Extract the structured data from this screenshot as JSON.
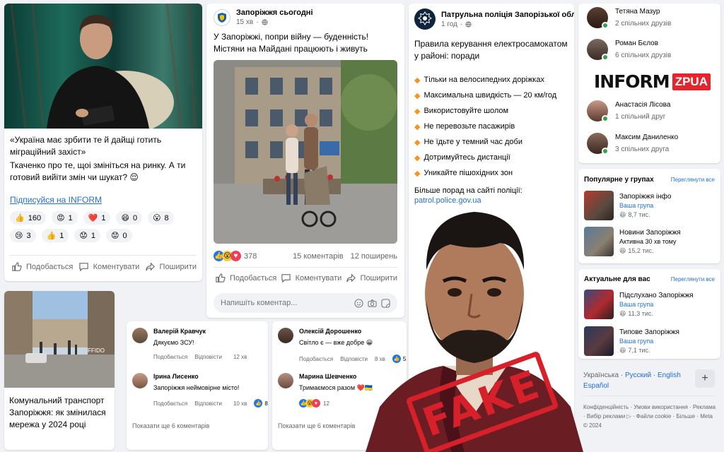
{
  "post1": {
    "quote": "«Україна має зрбити те й дайщі готить міграційний захіст»",
    "text": "Ткаченко про те, щоі змініться на ринку. А ти готовий вийіти змін чи шукат?",
    "text_emoji": "😌",
    "subscribe_link": "Підписуйся на INFORM",
    "reactions": [
      {
        "emoji": "👍",
        "count": "160"
      },
      {
        "emoji": "😡",
        "count": "1"
      },
      {
        "emoji": "❤️",
        "count": "1"
      },
      {
        "emoji": "😄",
        "count": "0"
      },
      {
        "emoji": "😮",
        "count": "8"
      },
      {
        "emoji": "😢",
        "count": "3"
      },
      {
        "emoji": "👍",
        "count": "1"
      },
      {
        "emoji": "😟",
        "count": "1"
      },
      {
        "emoji": "😟",
        "count": "0"
      }
    ],
    "like_label": "Подобається",
    "comment_label": "Коментувати",
    "share_label": "Поширити"
  },
  "post2": {
    "page_name": "Запоріжжя сьогодні",
    "time": "15 хв",
    "text": "У Запоріжжі, попри війну — буденність! Містяни на Майдані працюють і живуть",
    "reaction_count": "378",
    "comments": "15 коментарів",
    "shares": "12 поширень",
    "like_label": "Подобається",
    "comment_label": "Коментувати",
    "share_label": "Поширити",
    "comment_placeholder": "Напишіть коментар..."
  },
  "post3": {
    "page_name": "Патрульна поліція Запорізької області",
    "time": "1 год",
    "title": "Правила керування електросамокатом у районі: поради",
    "rules": [
      "Тільки на велосипедних доріжках",
      "Максимальна швидкість — 20 км/год",
      "Використовуйте шолом",
      "Не перевозьте пасажирів",
      "Не їдьте у темний час доби",
      "Дотримуйтесь дистанції",
      "Уникайте пішохідних зон"
    ],
    "more_text": "Більше порад на сайті поліції:",
    "more_link": "patrol.police.gov.ua"
  },
  "post4": {
    "photo_caption": "FFIDO",
    "text": "Комунальний транспорт Запоріжжя: як змінилася мережа у 2024 році"
  },
  "comments_left": {
    "items": [
      {
        "name": "Валерій Кравчук",
        "text": "Дякуємо ЗСУ!",
        "like": "Подобається",
        "reply": "Відповісти",
        "time": "12 хв",
        "reaction_count": ""
      },
      {
        "name": "Ірина Лисенко",
        "text": "Запоріжжя неймовірне місто!",
        "like": "Подобається",
        "reply": "Відповісти",
        "time": "10 хв",
        "reaction_count": "8"
      }
    ],
    "more": "Показати ще 6 коментарів"
  },
  "comments_right": {
    "items": [
      {
        "name": "Олексій Дорошенко",
        "text": "Світло є — вже добре 😀",
        "like": "Подобається",
        "reply": "Відповісти",
        "time": "8 хв",
        "reaction_count": "5"
      },
      {
        "name": "Марина Шевченко",
        "text": "Тримаємося разом ❤️🇺🇦",
        "like": "",
        "reply": "",
        "time": "",
        "reaction_count": "12"
      }
    ],
    "more": "Показати ще 6 коментарів"
  },
  "friends": [
    {
      "name": "Тетяна Мазур",
      "mutual": "2 спільних друзів"
    },
    {
      "name": "Роман Бєлов",
      "mutual": "6 спільних друзів"
    },
    {
      "name": "Анастасія Лісова",
      "mutual": "1 спільний друг"
    },
    {
      "name": "Максим Даниленко",
      "mutual": "3 спільних друга"
    }
  ],
  "logo": {
    "left": "INFORM",
    "right": "ZPUA"
  },
  "popular": {
    "title": "Популярне у групах",
    "see_all": "Переглянути все",
    "items": [
      {
        "name": "Запоріжжя інфо",
        "sub": "Ваша група",
        "count": "8,7 тис."
      },
      {
        "name": "Новини Запоріжжя",
        "sub": "Активна 30 хв тому",
        "count": "15,2 тис."
      }
    ]
  },
  "relevant": {
    "title": "Актуальне для вас",
    "see_all": "Переглянути все",
    "items": [
      {
        "name": "Підслухано Запоріжжя",
        "sub": "Ваша група",
        "count": "11,3 тис."
      },
      {
        "name": "Типове Запоріжжя",
        "sub": "Ваша група",
        "count": "7,1 тис."
      }
    ]
  },
  "languages": {
    "current": "Українська",
    "sep": " · ",
    "others": [
      "Русский",
      "English",
      "Español"
    ],
    "add": "+"
  },
  "footer": "Конфіденційність · Умови використання · Реклама · Вибір реклами ▷ · Файли cookie · Більше · Meta © 2024",
  "stamp": "FAKE",
  "colors": {
    "accent": "#216fdb",
    "stamp": "#d8202a",
    "online": "#31a24c"
  }
}
